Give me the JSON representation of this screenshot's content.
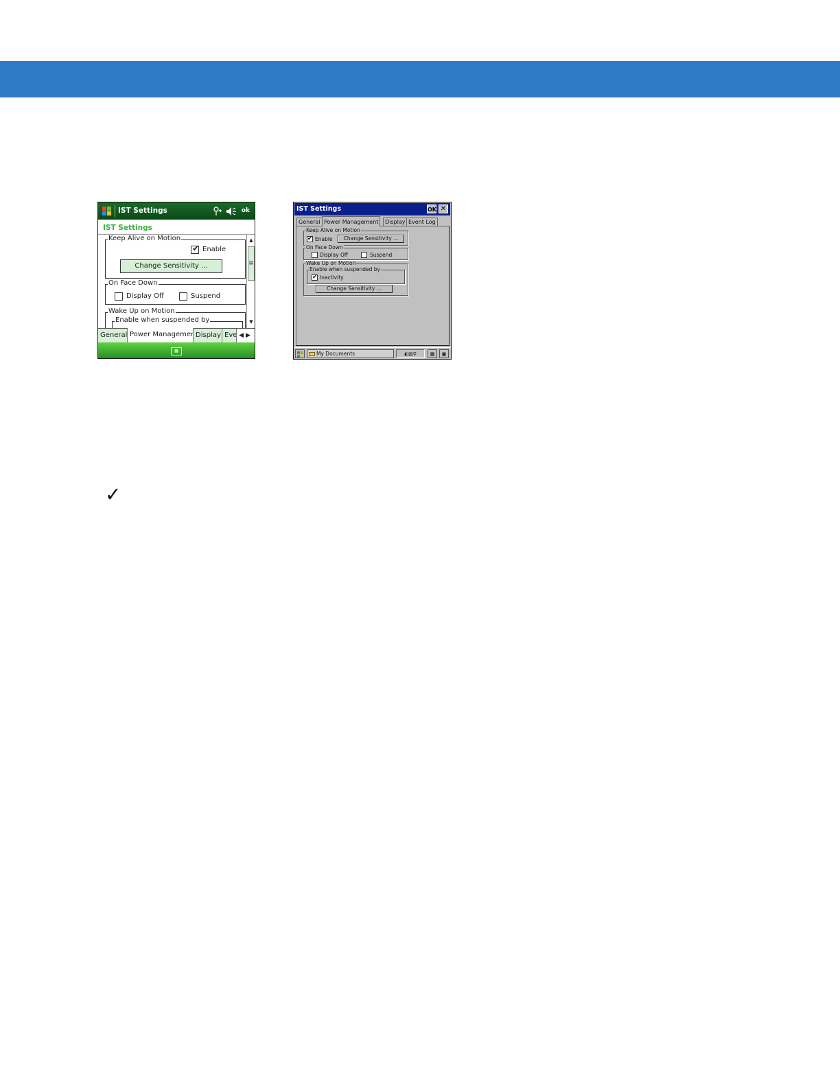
{
  "colors": {
    "header_band": "#2f7ac7",
    "wm_title_bar": "#0b4a18",
    "wm_accent": "#3dae3d",
    "ce_title_bar": "#0a1e8c"
  },
  "wm_screen": {
    "title": "IST Settings",
    "title_icons": [
      "windows-logo-icon",
      "connectivity-icon",
      "speaker-icon"
    ],
    "ok_label": "ok",
    "subtitle": "IST Settings",
    "keep_alive": {
      "label": "Keep Alive on Motion",
      "enable_label": "Enable",
      "enable_checked": true,
      "button": "Change Sensitivity ..."
    },
    "face_down": {
      "label": "On Face Down",
      "display_off": "Display Off",
      "display_off_checked": false,
      "suspend": "Suspend",
      "suspend_checked": false
    },
    "wake_up": {
      "label": "Wake Up on Motion",
      "inner_label": "Enable when suspended by"
    },
    "tabs": [
      "General",
      "Power Management",
      "Display",
      "Eve"
    ],
    "active_tab": "Power Management",
    "keyboard_icon": "keyboard-icon"
  },
  "ce_screen": {
    "title": "IST Settings",
    "ok_label": "OK",
    "close_label": "✕",
    "tabs": [
      "General",
      "Power Management",
      "Display",
      "Event Log"
    ],
    "active_tab": "Power Management",
    "keep_alive": {
      "label": "Keep Alive on Motion",
      "enable_label": "Enable",
      "enable_checked": true,
      "button": "Change Sensitivity ..."
    },
    "face_down": {
      "label": "On Face Down",
      "display_off": "Display Off",
      "display_off_checked": false,
      "suspend": "Suspend",
      "suspend_checked": false
    },
    "wake_up": {
      "label": "Wake Up on Motion",
      "inner_label": "Enable when suspended by",
      "inactivity_label": "Inactivity",
      "inactivity_checked": true,
      "button": "Change Sensitivity ..."
    },
    "taskbar": {
      "task_label": "My Documents"
    }
  },
  "note_icon": "checkmark-icon"
}
